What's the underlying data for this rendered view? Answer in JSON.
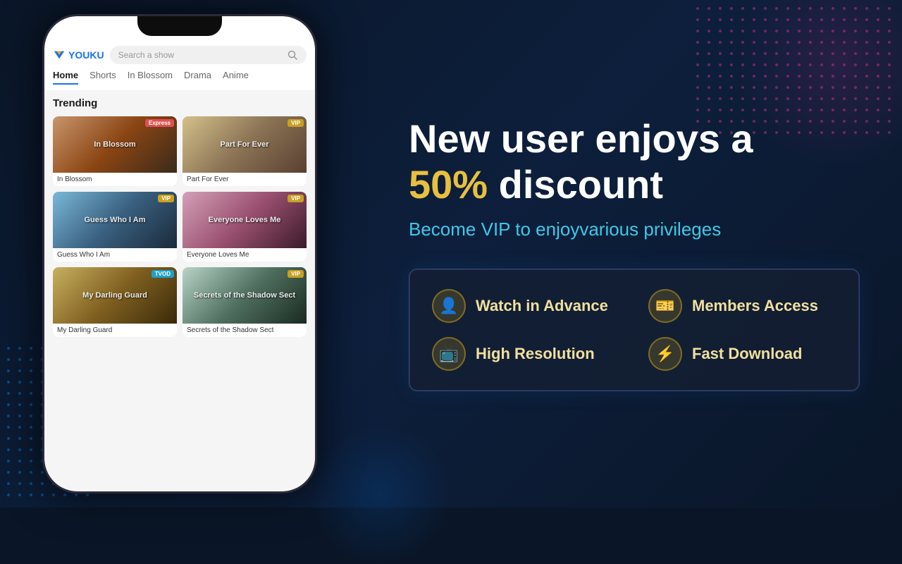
{
  "app": {
    "name": "YOUKU",
    "search_placeholder": "Search a show"
  },
  "nav": {
    "tabs": [
      {
        "label": "Home",
        "active": true
      },
      {
        "label": "Shorts",
        "active": false
      },
      {
        "label": "In Blossom",
        "active": false
      },
      {
        "label": "Drama",
        "active": false
      },
      {
        "label": "Anime",
        "active": false
      }
    ]
  },
  "trending": {
    "title": "Trending",
    "shows": [
      {
        "title": "In Blossom",
        "badge": "Express",
        "badge_type": "express",
        "thumb_class": "thumb-blossom",
        "thumb_text": "In Blossom"
      },
      {
        "title": "Part For Ever",
        "badge": "VIP",
        "badge_type": "vip",
        "thumb_class": "thumb-partforever",
        "thumb_text": "Part For Ever"
      },
      {
        "title": "Guess Who I Am",
        "badge": "VIP",
        "badge_type": "vip",
        "thumb_class": "thumb-guesswho",
        "thumb_text": "Guess Who I Am"
      },
      {
        "title": "Everyone Loves Me",
        "badge": "VIP",
        "badge_type": "vip",
        "thumb_class": "thumb-everyoneloves",
        "thumb_text": "Everyone Loves Me"
      },
      {
        "title": "My Darling Guard",
        "badge": "TVOD",
        "badge_type": "tvod",
        "thumb_class": "thumb-mydarling",
        "thumb_text": "My Darling Guard"
      },
      {
        "title": "Secrets of the Shadow Sect",
        "badge": "VIP",
        "badge_type": "vip",
        "thumb_class": "thumb-secrets",
        "thumb_text": "Secrets of the Shadow Sect"
      }
    ]
  },
  "promo": {
    "headline_line1": "New user enjoys a",
    "headline_line2": "50%",
    "headline_line3": "discount",
    "sub": "Become VIP to enjoyvarious privileges",
    "features": [
      {
        "icon": "👤",
        "label": "Watch in Advance"
      },
      {
        "icon": "🎫",
        "label": "Members Access"
      },
      {
        "icon": "📺",
        "label": "High Resolution"
      },
      {
        "icon": "⚡",
        "label": "Fast Download"
      }
    ]
  }
}
